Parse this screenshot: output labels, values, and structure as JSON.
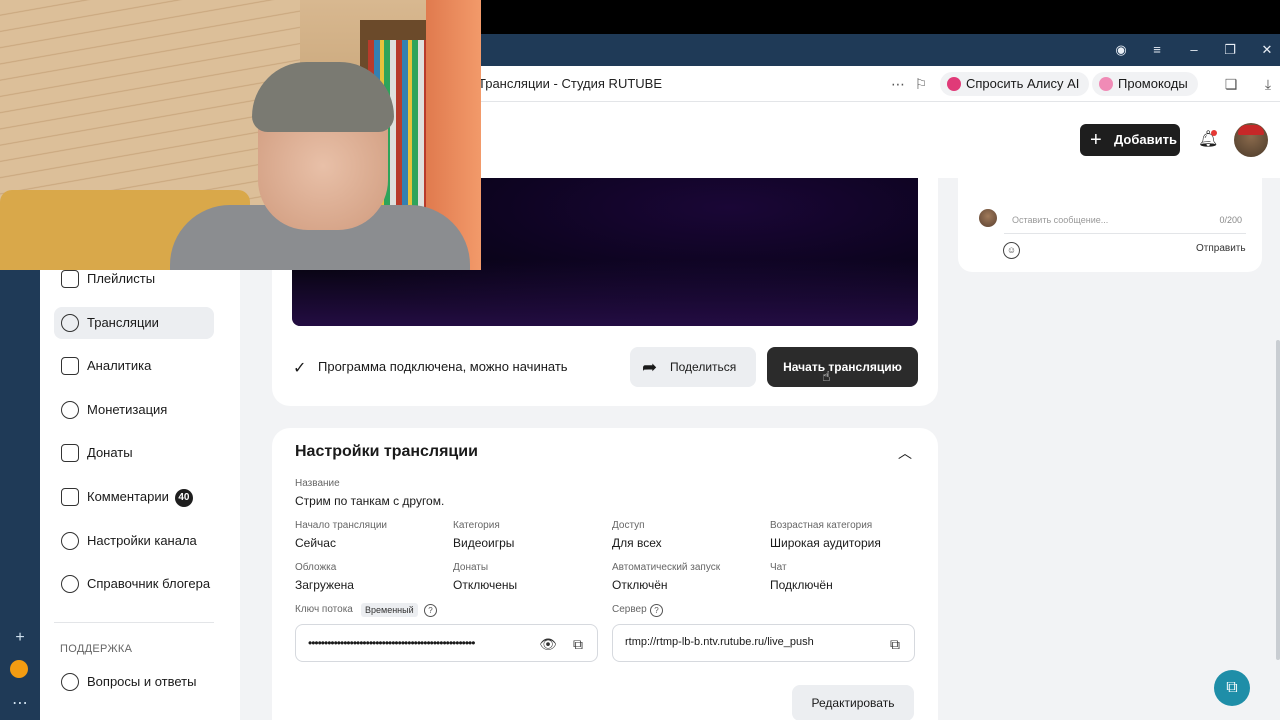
{
  "browser": {
    "tab_title": "Трансляции - Студия RUTUBE",
    "alice_label": "Спросить Алису AI",
    "promo_label": "Промокоды"
  },
  "header": {
    "add_button": "Добавить"
  },
  "sidebar": {
    "items": [
      {
        "label": "Плейлисты"
      },
      {
        "label": "Трансляции"
      },
      {
        "label": "Аналитика"
      },
      {
        "label": "Монетизация"
      },
      {
        "label": "Донаты"
      },
      {
        "label": "Комментарии",
        "badge": "40"
      },
      {
        "label": "Настройки канала"
      },
      {
        "label": "Справочник блогера"
      }
    ],
    "section_title": "ПОДДЕРЖКА",
    "support_item": "Вопросы и ответы"
  },
  "stream": {
    "status_text": "Программа подключена, можно начинать",
    "share_button": "Поделиться",
    "start_button": "Начать трансляцию"
  },
  "settings": {
    "title": "Настройки трансляции",
    "name_label": "Название",
    "name_value": "Стрим по танкам с другом.",
    "start_label": "Начало трансляции",
    "start_value": "Сейчас",
    "category_label": "Категория",
    "category_value": "Видеоигры",
    "access_label": "Доступ",
    "access_value": "Для всех",
    "age_label": "Возрастная категория",
    "age_value": "Широкая аудитория",
    "cover_label": "Обложка",
    "cover_value": "Загружена",
    "donations_label": "Донаты",
    "donations_value": "Отключены",
    "autostart_label": "Автоматический запуск",
    "autostart_value": "Отключён",
    "chat_label": "Чат",
    "chat_value": "Подключён",
    "key_label": "Ключ потока",
    "key_tag": "Временный",
    "key_value": "••••••••••••••••••••••••••••••••••••••••••••••••••••",
    "server_label": "Сервер",
    "server_value": "rtmp://rtmp-lb-b.ntv.rutube.ru/live_push",
    "edit_button": "Редактировать"
  },
  "chat": {
    "placeholder": "Оставить сообщение...",
    "counter": "0/200",
    "send_button": "Отправить"
  },
  "colors": {
    "accent_dark": "#1e1e1e",
    "fab": "#1f8ea8",
    "chrome": "#1f3a57"
  }
}
